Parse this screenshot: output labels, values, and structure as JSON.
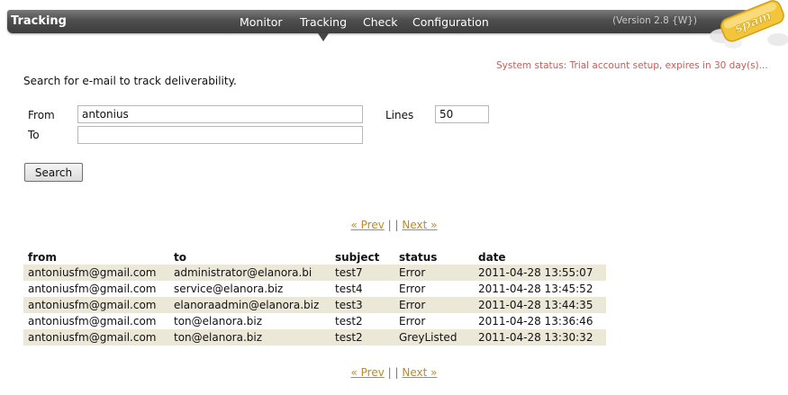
{
  "header": {
    "title": "Tracking",
    "nav": [
      "Monitor",
      "Tracking",
      "Check",
      "Configuration"
    ],
    "active_nav": "Tracking",
    "version": "(Version 2.8 {W})",
    "logo_text": "spam"
  },
  "status": "System status: Trial account setup, expires in 30 day(s)...",
  "intro": "Search for e-mail to track deliverability.",
  "form": {
    "from_label": "From",
    "from_value": "antonius",
    "to_label": "To",
    "to_value": "",
    "lines_label": "Lines",
    "lines_value": "50",
    "search_label": "Search"
  },
  "pager": {
    "prev": "« Prev",
    "sep": "| |",
    "next": "Next »"
  },
  "table": {
    "headers": [
      "from",
      "to",
      "subject",
      "status",
      "date"
    ],
    "rows": [
      [
        "antoniusfm@gmail.com",
        "administrator@elanora.bi",
        "test7",
        "Error",
        "2011-04-28 13:55:07"
      ],
      [
        "antoniusfm@gmail.com",
        "service@elanora.biz",
        "test4",
        "Error",
        "2011-04-28 13:45:52"
      ],
      [
        "antoniusfm@gmail.com",
        "elanoraadmin@elanora.biz",
        "test3",
        "Error",
        "2011-04-28 13:44:35"
      ],
      [
        "antoniusfm@gmail.com",
        "ton@elanora.biz",
        "test2",
        "Error",
        "2011-04-28 13:36:46"
      ],
      [
        "antoniusfm@gmail.com",
        "ton@elanora.biz",
        "test2",
        "GreyListed",
        "2011-04-28 13:30:32"
      ]
    ]
  },
  "colors": {
    "accent_link": "#c08a1e",
    "status_text": "#c0605a",
    "row_stripe": "#ece8d8"
  }
}
